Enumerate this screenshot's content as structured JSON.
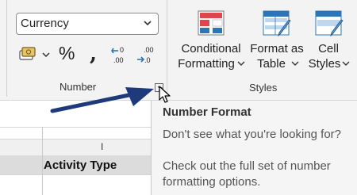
{
  "ribbon": {
    "number_group": {
      "format_select": {
        "value": "Currency"
      },
      "buttons": [
        {
          "name": "accounting-format",
          "icon": "accounting-format-icon"
        },
        {
          "name": "percent-style",
          "label": "%"
        },
        {
          "name": "comma-style",
          "label": ","
        },
        {
          "name": "increase-decimal",
          "icon": "increase-decimal-icon"
        },
        {
          "name": "decrease-decimal",
          "icon": "decrease-decimal-icon"
        }
      ],
      "label": "Number"
    },
    "styles_group": {
      "buttons": [
        {
          "line1": "Conditional",
          "line2": "Formatting",
          "icon": "conditional-formatting-icon"
        },
        {
          "line1": "Format as",
          "line2": "Table",
          "icon": "format-as-table-icon"
        },
        {
          "line1": "Cell",
          "line2": "Styles",
          "icon": "cell-styles-icon"
        }
      ],
      "label": "Styles"
    }
  },
  "sheet": {
    "column_header": "I",
    "header_cell": "Activity Type"
  },
  "tooltip": {
    "title": "Number Format",
    "question": "Don't see what you're looking for?",
    "description_line1": "Check out the full set of number",
    "description_line2": "formatting options."
  },
  "colors": {
    "arrow": "#1f3a7a",
    "accent_red": "#e0444c",
    "accent_blue": "#2e75b6"
  }
}
